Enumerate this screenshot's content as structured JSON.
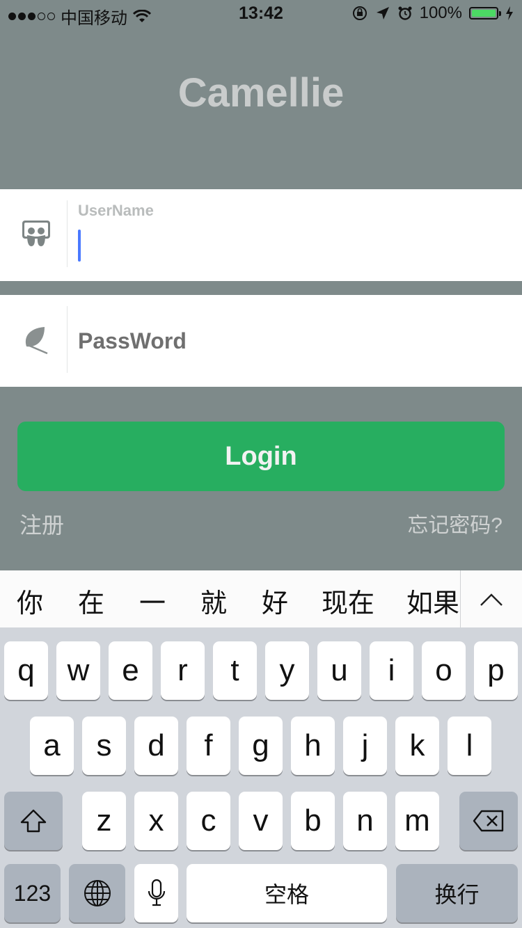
{
  "status_bar": {
    "carrier": "中国移动",
    "time": "13:42",
    "battery_percent": "100%",
    "battery_level": 1.0
  },
  "app": {
    "title": "Camellie"
  },
  "username_field": {
    "label": "UserName",
    "value": "",
    "icon": "slideshare-icon"
  },
  "password_field": {
    "placeholder": "PassWord",
    "value": "",
    "icon": "leaf-icon"
  },
  "login_button": {
    "label": "Login"
  },
  "register_link": {
    "label": "注册"
  },
  "forgot_link": {
    "label": "忘记密码?"
  },
  "keyboard": {
    "suggestions": [
      "你",
      "在",
      "一",
      "就",
      "好",
      "现在",
      "如果"
    ],
    "row1": [
      "q",
      "w",
      "e",
      "r",
      "t",
      "y",
      "u",
      "i",
      "o",
      "p"
    ],
    "row2": [
      "a",
      "s",
      "d",
      "f",
      "g",
      "h",
      "j",
      "k",
      "l"
    ],
    "row3": [
      "z",
      "x",
      "c",
      "v",
      "b",
      "n",
      "m"
    ],
    "numbers_key": "123",
    "space_key": "空格",
    "return_key": "换行"
  },
  "colors": {
    "background": "#7e8a8a",
    "login_button": "#27ae60",
    "caret": "#4a79ff"
  }
}
